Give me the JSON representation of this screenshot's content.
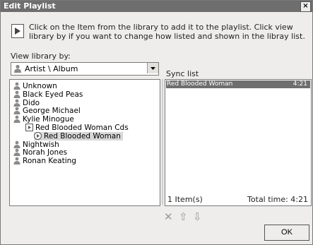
{
  "window": {
    "title": "Edit Playlist",
    "close_glyph": "×"
  },
  "instructions": "Click on the Item from the library to add it to the playlist. Click view library by if you want to change how listed and shown in the libray list.",
  "view_label": "View library by:",
  "view_select": {
    "value": "Artist \\ Album"
  },
  "sync_label": "Sync list",
  "tree": [
    {
      "label": "Unknown",
      "icon": "user-icon",
      "level": 0
    },
    {
      "label": "Black Eyed Peas",
      "icon": "user-icon",
      "level": 0
    },
    {
      "label": "Dido",
      "icon": "user-icon",
      "level": 0
    },
    {
      "label": "George Michael",
      "icon": "user-icon",
      "level": 0
    },
    {
      "label": "Kylie Minogue",
      "icon": "user-icon",
      "level": 0
    },
    {
      "label": "Red Blooded Woman Cds",
      "icon": "cd-icon",
      "level": 1
    },
    {
      "label": "Red Blooded Woman",
      "icon": "disc-icon",
      "level": 2,
      "selected": true
    },
    {
      "label": "Nightwish",
      "icon": "user-icon",
      "level": 0
    },
    {
      "label": "Norah Jones",
      "icon": "user-icon",
      "level": 0
    },
    {
      "label": "Ronan Keating",
      "icon": "user-icon",
      "level": 0
    }
  ],
  "sync": {
    "rows": [
      {
        "title": "Red Blooded Woman",
        "duration": "4:21"
      }
    ],
    "count": "1 Item(s)",
    "total": "Total time: 4:21"
  },
  "controls": {
    "remove": "✕",
    "up": "⇧",
    "down": "⇩"
  },
  "ok_label": "OK"
}
